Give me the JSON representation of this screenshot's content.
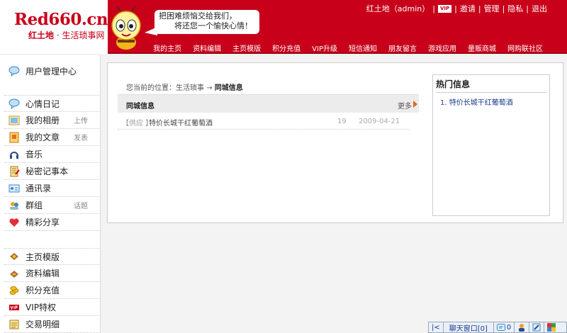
{
  "header": {
    "logo_text": "Red660.cn",
    "logo_brand": "红土地",
    "logo_dot": "·",
    "logo_tagline": "生活琐事网",
    "slogan_line1": "把困难烦恼交给我们，",
    "slogan_line2": "将还您一个愉快心情！",
    "user_link": "红土地（admin）",
    "vip_badge": "VIP",
    "invite_link": "邀请",
    "manage_link": "管理",
    "privacy_link": "隐私",
    "logout_link": "退出",
    "separator": "|",
    "colors": {
      "brand": "#c8001a"
    }
  },
  "nav": {
    "items": [
      "我的主页",
      "资料编辑",
      "主页模版",
      "积分充值",
      "VIP升级",
      "短信通知",
      "朋友留言",
      "游戏应用",
      "量贩商城",
      "网购联社区"
    ]
  },
  "sidebar": {
    "items": [
      {
        "label": "用户管理中心",
        "icon": "chat-bubble-icon",
        "extra": ""
      },
      {
        "label": "心情日记",
        "icon": "chat-bubble-icon",
        "extra": ""
      },
      {
        "label": "我的相册",
        "icon": "photo-icon",
        "extra": "上传"
      },
      {
        "label": "我的文章",
        "icon": "document-icon",
        "extra": "发表"
      },
      {
        "label": "音乐",
        "icon": "headphones-icon",
        "extra": ""
      },
      {
        "label": "秘密记事本",
        "icon": "notebook-icon",
        "extra": ""
      },
      {
        "label": "通讯录",
        "icon": "contact-card-icon",
        "extra": ""
      },
      {
        "label": "群组",
        "icon": "group-icon",
        "extra": "话题"
      },
      {
        "label": "精彩分享",
        "icon": "heart-icon",
        "extra": ""
      },
      {
        "label": "主页模版",
        "icon": "template-icon",
        "extra": ""
      },
      {
        "label": "资料编辑",
        "icon": "edit-icon",
        "extra": ""
      },
      {
        "label": "积分充值",
        "icon": "coins-icon",
        "extra": ""
      },
      {
        "label": "VIP特权",
        "icon": "vip-icon",
        "extra": ""
      },
      {
        "label": "交易明细",
        "icon": "ledger-icon",
        "extra": ""
      }
    ]
  },
  "main": {
    "breadcrumb_prefix": "您当前的位置：生活琐事",
    "breadcrumb_arrow": "→",
    "breadcrumb_current": "同城信息",
    "list_title": "同城信息",
    "more_label": "更多",
    "rows": [
      {
        "category": "【供应 】",
        "title": "特价长城干红葡萄酒",
        "count": "19",
        "date": "2009-04-21"
      }
    ]
  },
  "hot": {
    "title": "热门信息",
    "items": [
      "1. 特价长城干红葡萄酒"
    ]
  },
  "chatbar": {
    "collapse": "|<",
    "chat_window": "聊天窗口[0]",
    "messages": "0"
  }
}
